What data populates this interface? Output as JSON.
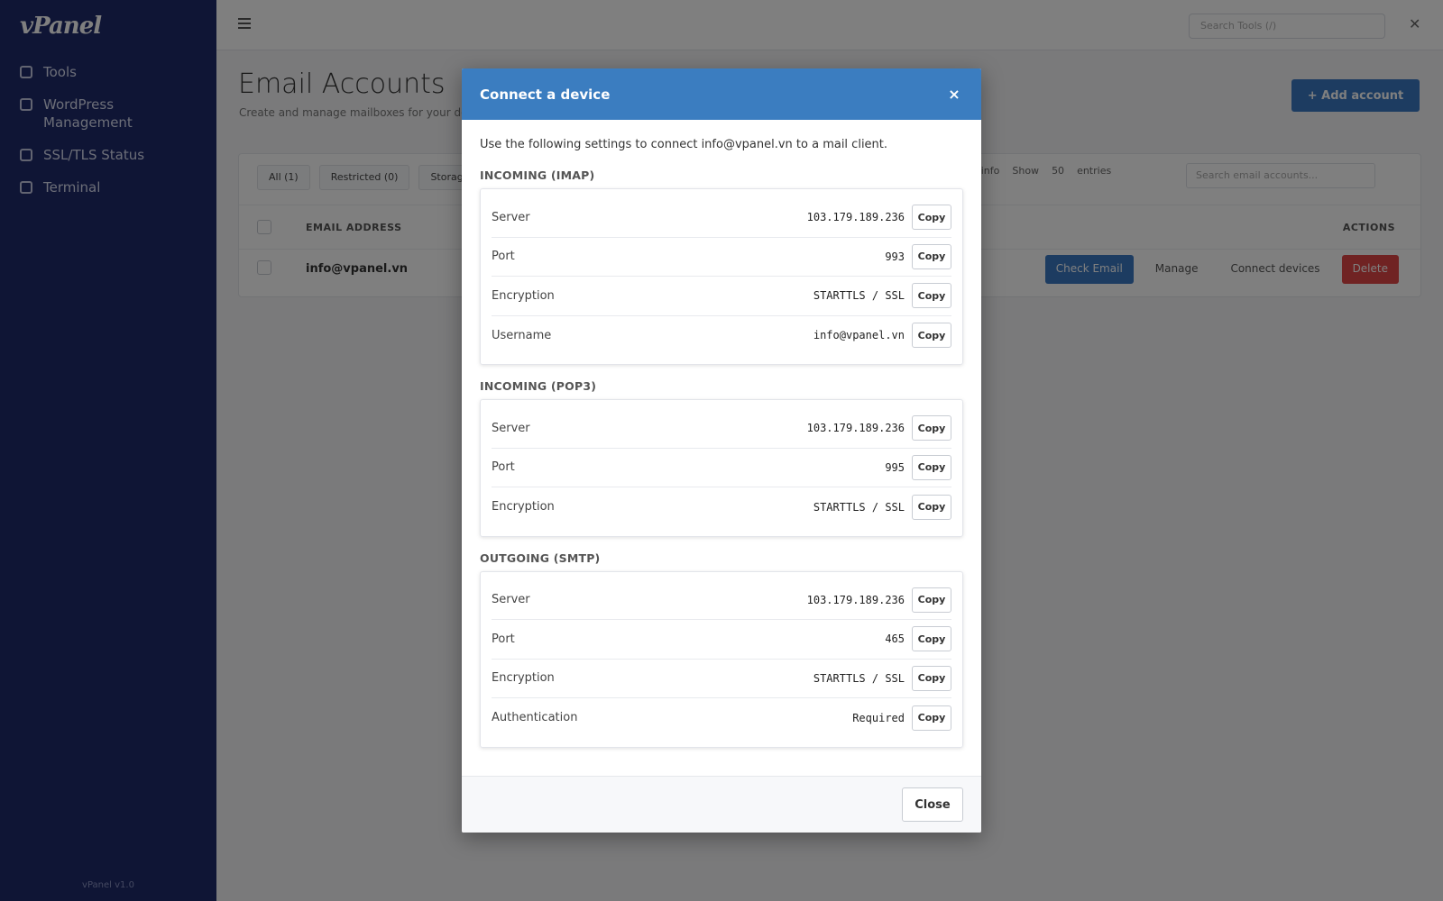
{
  "sidebar": {
    "logo": "vPanel",
    "items": [
      {
        "label": "Tools",
        "icon": "wrench-icon"
      },
      {
        "label": "WordPress Management",
        "icon": "wordpress-icon"
      },
      {
        "label": "SSL/TLS Status",
        "icon": "lock-icon"
      },
      {
        "label": "Terminal",
        "icon": "terminal-icon"
      }
    ],
    "footer": "vPanel v1.0"
  },
  "topbar": {
    "search_placeholder": "Search Tools (/)",
    "close": "✕"
  },
  "page": {
    "title": "Email Accounts",
    "subtitle": "Create and manage mailboxes for your domain.",
    "add_button": "+ Add account"
  },
  "table": {
    "filters": [
      "All (1)",
      "Restricted (0)",
      "Storage"
    ],
    "tools": [
      "Bypass info",
      "Show",
      "50",
      "entries"
    ],
    "search_placeholder": "Search email accounts...",
    "headers": {
      "email": "EMAIL ADDRESS",
      "actions": "ACTIONS"
    },
    "row": {
      "email": "info@vpanel.vn",
      "actions": [
        "Check Email",
        "Manage",
        "Connect devices",
        "Delete"
      ]
    }
  },
  "modal": {
    "title": "Connect a device",
    "close_icon": "×",
    "intro": "Use the following settings to connect info@vpanel.vn to a mail client.",
    "copy_label": "Copy",
    "close_label": "Close",
    "sections": [
      {
        "title": "INCOMING (IMAP)",
        "rows": [
          {
            "label": "Server",
            "value": "103.179.189.236"
          },
          {
            "label": "Port",
            "value": "993"
          },
          {
            "label": "Encryption",
            "value": "STARTTLS / SSL"
          },
          {
            "label": "Username",
            "value": "info@vpanel.vn"
          }
        ]
      },
      {
        "title": "INCOMING (POP3)",
        "rows": [
          {
            "label": "Server",
            "value": "103.179.189.236"
          },
          {
            "label": "Port",
            "value": "995"
          },
          {
            "label": "Encryption",
            "value": "STARTTLS / SSL"
          }
        ]
      },
      {
        "title": "OUTGOING (SMTP)",
        "rows": [
          {
            "label": "Server",
            "value": "103.179.189.236"
          },
          {
            "label": "Port",
            "value": "465"
          },
          {
            "label": "Encryption",
            "value": "STARTTLS / SSL"
          },
          {
            "label": "Authentication",
            "value": "Required"
          }
        ]
      }
    ]
  },
  "colors": {
    "sidebar": "#1e2a6b",
    "modal_header": "#3b7dc0",
    "primary": "#3b78c2",
    "danger": "#e04646"
  }
}
